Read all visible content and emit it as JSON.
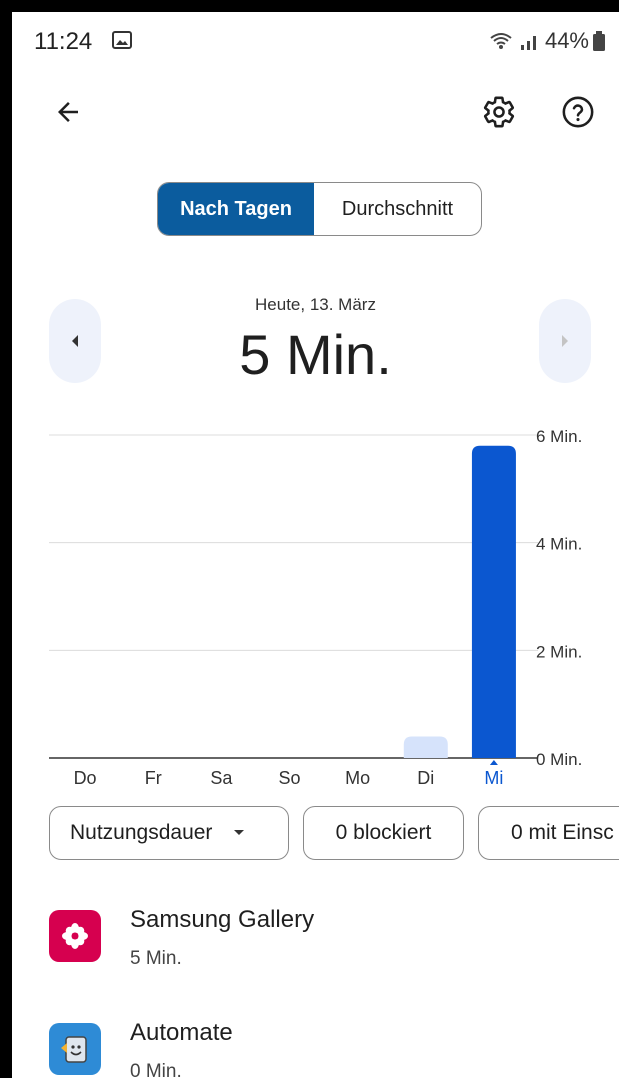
{
  "status_bar": {
    "time": "11:24",
    "battery": "44%"
  },
  "toolbar": {
    "back_icon": "arrow-back-icon",
    "settings_icon": "gear-icon",
    "help_icon": "help-icon"
  },
  "segmented": {
    "left_label": "Nach Tagen",
    "right_label": "Durchschnitt",
    "selected": "Nach Tagen"
  },
  "summary": {
    "date": "Heute, 13. März",
    "total": "5 Min."
  },
  "chart_data": {
    "type": "bar",
    "categories": [
      "Do",
      "Fr",
      "Sa",
      "So",
      "Mo",
      "Di",
      "Mi"
    ],
    "values": [
      0,
      0,
      0,
      0,
      0,
      0.4,
      5.8
    ],
    "selected_index": 6,
    "y_ticks": [
      "6 Min.",
      "4 Min.",
      "2 Min.",
      "0 Min."
    ],
    "ylim": [
      0,
      6
    ],
    "grid": true,
    "colors": {
      "selected": "#0b57d0",
      "other": "#d6e3fb",
      "selected_label": "#0b57d0"
    }
  },
  "filters": {
    "usage": "Nutzungsdauer",
    "blocked": "0 blockiert",
    "restricted": "0 mit Einsc"
  },
  "apps": [
    {
      "name": "Samsung Gallery",
      "time": "5 Min.",
      "icon": "flower-icon",
      "color": "#d6004f"
    },
    {
      "name": "Automate",
      "time": "0 Min.",
      "icon": "automate-icon",
      "color": "#2e8bd6"
    }
  ]
}
